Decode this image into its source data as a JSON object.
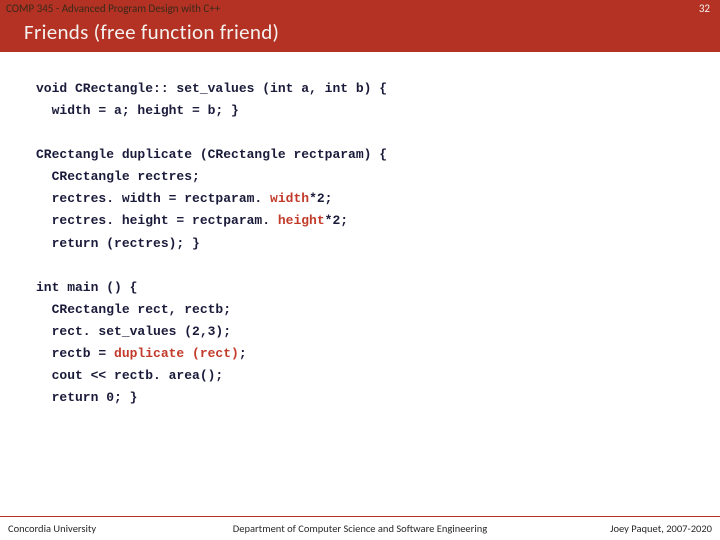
{
  "header": {
    "course": "COMP 345 - Advanced Program Design with C++",
    "page": "32",
    "title": "Friends (free function friend)"
  },
  "code": {
    "l1a": "void CRectangle:: set_values (int a, int b) {",
    "l2a": "  width = a; height = b; }",
    "l3a": "CRectangle duplicate (CRectangle rectparam) {",
    "l4a": "  CRectangle rectres;",
    "l5a": "  rectres. width = rectparam.",
    "l5b": " width",
    "l5c": "*2;",
    "l6a": "  rectres. height = rectparam.",
    "l6b": " height",
    "l6c": "*2;",
    "l7a": "  return (rectres); }",
    "l8a": "int main () {",
    "l9a": "  CRectangle rect, rectb;",
    "l10a": "  rect. set_values (2,3);",
    "l11a": "  rectb =",
    "l11b": " duplicate (rect)",
    "l11c": ";",
    "l12a": "  cout << rectb. area();",
    "l13a": "  return 0; }"
  },
  "footer": {
    "left": "Concordia University",
    "center": "Department of Computer Science and Software Engineering",
    "right": "Joey Paquet, 2007-2020"
  }
}
